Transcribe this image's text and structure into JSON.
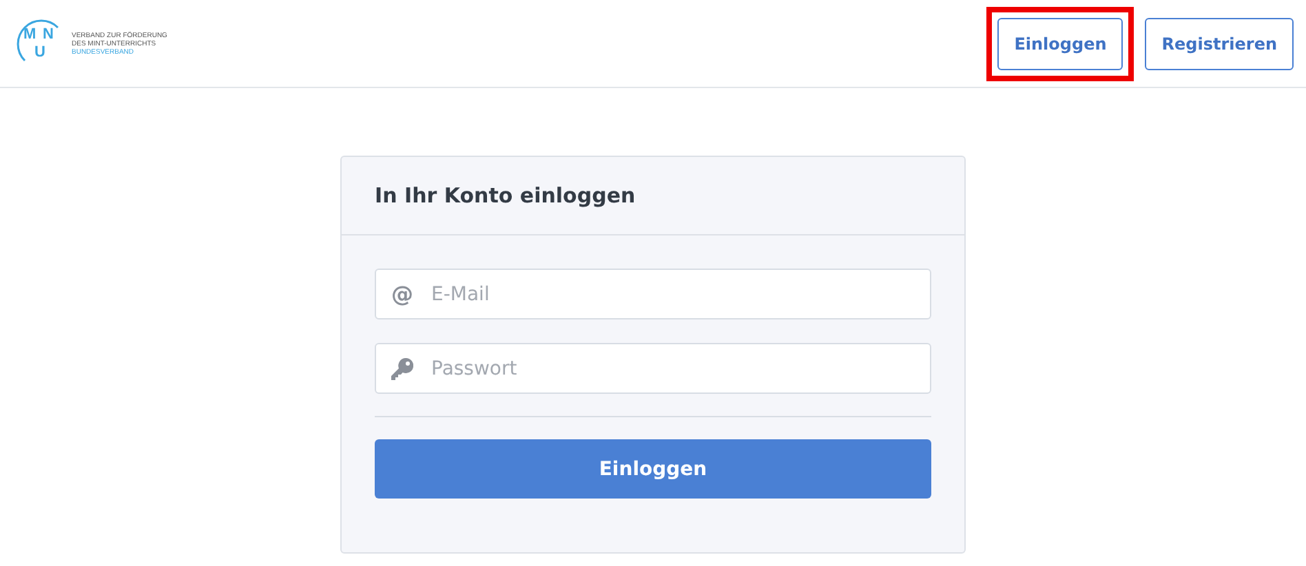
{
  "header": {
    "logo": {
      "letters": [
        "M",
        "N",
        "U"
      ],
      "lines": [
        "VERBAND ZUR FÖRDERUNG",
        "DES MINT-UNTERRICHTS"
      ],
      "subline": "BUNDESVERBAND"
    },
    "buttons": [
      {
        "label": "Einloggen",
        "highlighted": true
      },
      {
        "label": "Registrieren",
        "highlighted": false
      }
    ]
  },
  "login": {
    "title": "In Ihr Konto einloggen",
    "fields": [
      {
        "kind": "email",
        "icon": "@",
        "placeholder": "E-Mail"
      },
      {
        "kind": "password",
        "placeholder": "Passwort"
      }
    ],
    "submit": "Einloggen"
  }
}
